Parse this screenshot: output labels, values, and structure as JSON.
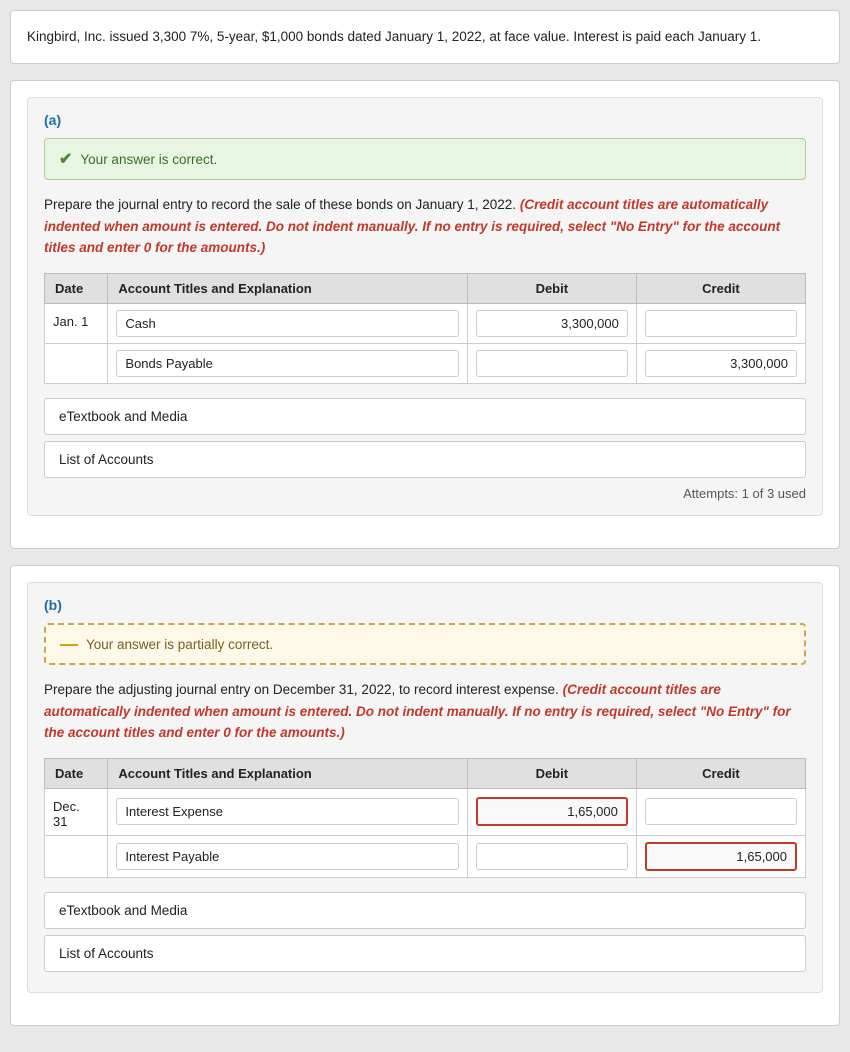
{
  "problem": {
    "description": "Kingbird, Inc. issued 3,300 7%, 5-year, $1,000 bonds dated January 1, 2022, at face value. Interest is paid each January 1."
  },
  "section_a": {
    "label": "(a)",
    "answer_status": "Your answer is correct.",
    "instruction_plain": "Prepare the journal entry to record the sale of these bonds on January 1, 2022.",
    "instruction_italic": "(Credit account titles are automatically indented when amount is entered. Do not indent manually. If no entry is required, select \"No Entry\" for the account titles and enter 0 for the amounts.)",
    "table": {
      "headers": [
        "Date",
        "Account Titles and Explanation",
        "Debit",
        "Credit"
      ],
      "rows": [
        {
          "date": "Jan. 1",
          "account1": "Cash",
          "debit1": "3,300,000",
          "credit1": "",
          "account2": "Bonds Payable",
          "debit2": "",
          "credit2": "3,300,000"
        }
      ]
    },
    "etextbook_label": "eTextbook and Media",
    "list_of_accounts_label": "List of Accounts",
    "attempts": "Attempts: 1 of 3 used"
  },
  "section_b": {
    "label": "(b)",
    "answer_status": "Your answer is partially correct.",
    "instruction_plain": "Prepare the adjusting journal entry on December 31, 2022, to record interest expense.",
    "instruction_italic": "(Credit account titles are automatically indented when amount is entered. Do not indent manually. If no entry is required, select \"No Entry\" for the account titles and enter 0 for the amounts.)",
    "table": {
      "headers": [
        "Date",
        "Account Titles and Explanation",
        "Debit",
        "Credit"
      ],
      "rows": [
        {
          "date": "Dec.\n31",
          "account1": "Interest Expense",
          "debit1": "1,65,000",
          "credit1": "",
          "account2": "Interest Payable",
          "debit2": "",
          "credit2": "1,65,000"
        }
      ]
    },
    "etextbook_label": "eTextbook and Media",
    "list_of_accounts_label": "List of Accounts"
  }
}
